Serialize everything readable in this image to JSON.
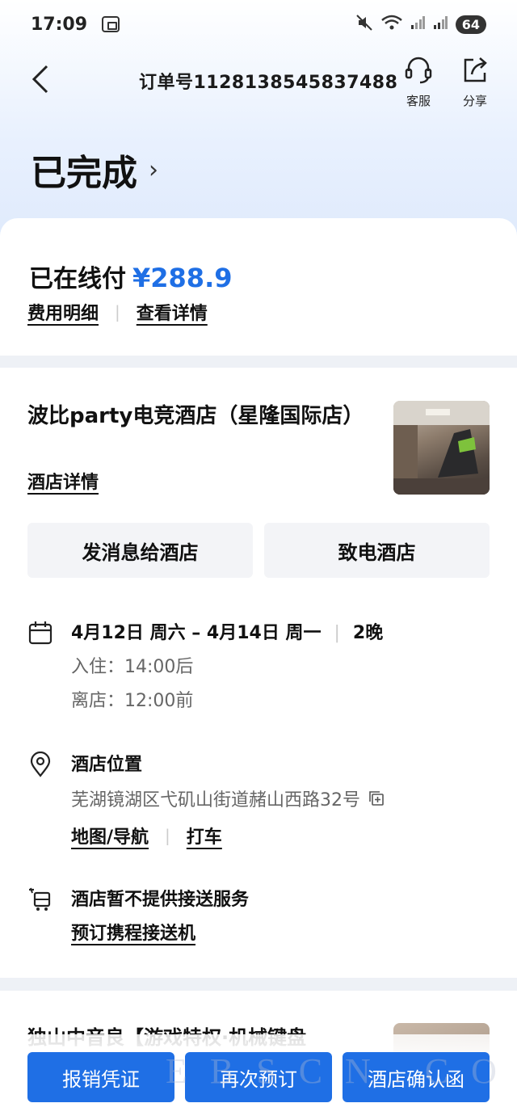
{
  "status_bar": {
    "time": "17:09",
    "battery": "64"
  },
  "header": {
    "order_number": "订单号1128138545837488",
    "service_label": "客服",
    "share_label": "分享",
    "order_status": "已完成"
  },
  "payment": {
    "paid_label": "已在线付",
    "paid_amount": "¥288.9",
    "fee_detail_link": "费用明细",
    "view_detail_link": "查看详情"
  },
  "hotel": {
    "name": "波比party电竞酒店（星隆国际店）",
    "detail_link": "酒店详情",
    "message_button": "发消息给酒店",
    "call_button": "致电酒店",
    "dates": "4月12日 周六 – 4月14日 周一",
    "nights": "2晚",
    "checkin": "入住：14:00后",
    "checkout": "离店：12:00前",
    "location_title": "酒店位置",
    "address": "芜湖镜湖区弋矶山街道赭山西路32号",
    "map_link": "地图/导航",
    "taxi_link": "打车",
    "shuttle_title": "酒店暂不提供接送服务",
    "shuttle_link": "预订携程接送机"
  },
  "next_card": {
    "title": "独山中音良【游戏特权·机械键盘"
  },
  "bottom_actions": {
    "reimburse": "报销凭证",
    "rebook": "再次预订",
    "confirmation": "酒店确认函"
  },
  "watermark": "EBSCN.COM.CN",
  "colors": {
    "accent": "#1f6fe5"
  }
}
